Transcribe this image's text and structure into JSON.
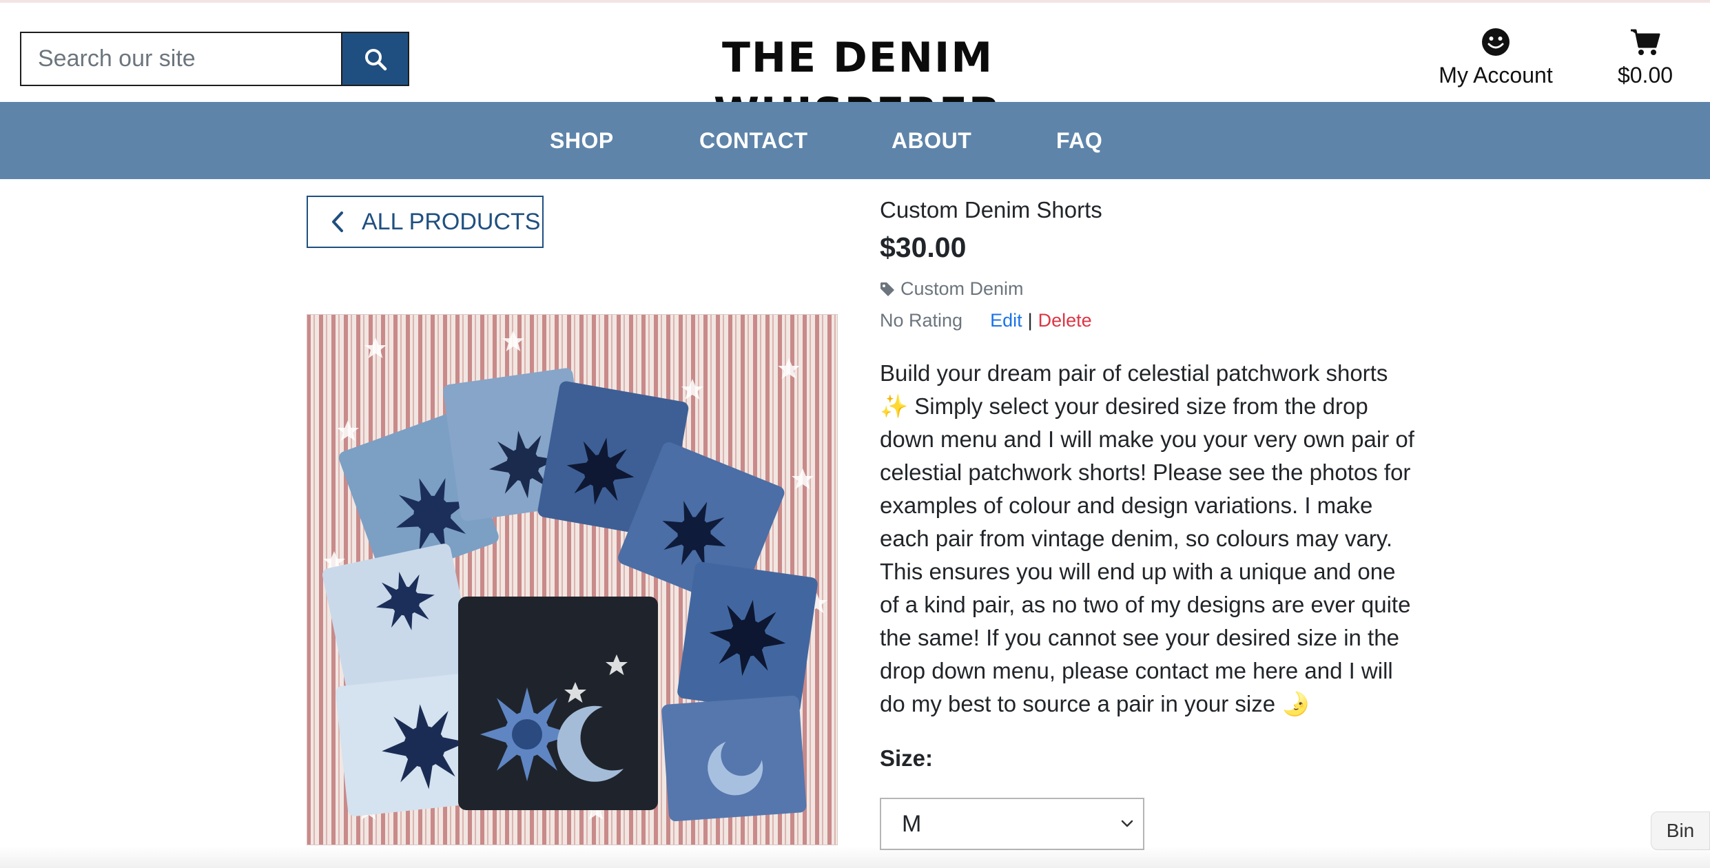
{
  "header": {
    "search_placeholder": "Search our site",
    "logo_text": "THE DENIM WHISPERER",
    "account_label": "My Account",
    "cart_total": "$0.00",
    "account_icon": "smiley-icon",
    "cart_icon": "shopping-cart-icon",
    "search_icon": "magnifier-icon"
  },
  "nav": {
    "items": [
      {
        "label": "SHOP"
      },
      {
        "label": "CONTACT"
      },
      {
        "label": "ABOUT"
      },
      {
        "label": "FAQ"
      }
    ]
  },
  "back_button": {
    "label": "ALL PRODUCTS"
  },
  "product": {
    "title": "Custom Denim Shorts",
    "price": "$30.00",
    "category": "Custom Denim",
    "rating": "No Rating",
    "edit_label": "Edit",
    "separator": "|",
    "delete_label": "Delete",
    "description_lines": [
      "Build your dream pair of celestial patchwork shorts",
      "✨ Simply select your desired size from the drop",
      "down menu and I will make you your very own pair of",
      "celestial patchwork shorts! Please see the photos for",
      "examples of colour and design variations. I make",
      "each pair from vintage denim, so colours may vary.",
      "This ensures you will end up with a unique and one",
      "of a kind pair, as no two of my designs are ever quite",
      "the same! If you cannot see your desired size in the",
      "drop down menu, please contact me here and I will",
      "do my best to source a pair in your size 🌛"
    ],
    "size_label": "Size:",
    "size_selected": "M"
  },
  "bin_tab": {
    "label": "Bin"
  },
  "colors": {
    "nav_bg": "#5e84aa",
    "brand_dark_blue": "#1f4f80",
    "edit_link": "#1a73e8",
    "delete_link": "#dc3545"
  }
}
